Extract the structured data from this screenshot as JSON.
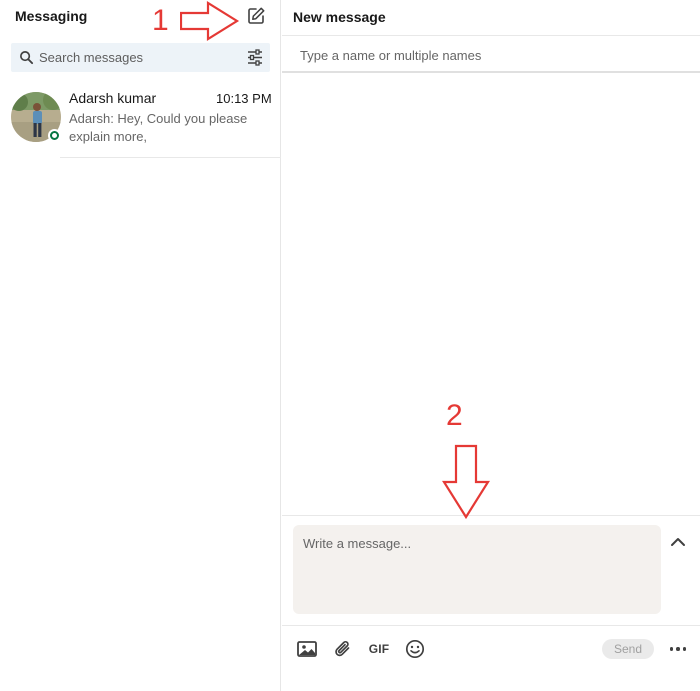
{
  "sidebar": {
    "title": "Messaging",
    "compose_icon": "compose-icon",
    "search": {
      "placeholder": "Search messages",
      "icon": "search-icon",
      "filter_icon": "filter-icon"
    },
    "conversations": [
      {
        "name": "Adarsh kumar",
        "time": "10:13 PM",
        "snippet": "Adarsh: Hey, Could you please explain more,",
        "status": "online"
      }
    ]
  },
  "main": {
    "title": "New message",
    "recipient_placeholder": "Type a name or multiple names",
    "composer": {
      "placeholder": "Write a message...",
      "expand_icon": "chevron-up-icon"
    },
    "toolbar": {
      "image_icon": "image-icon",
      "attach_icon": "paperclip-icon",
      "gif_label": "GIF",
      "emoji_icon": "emoji-icon",
      "send_label": "Send",
      "more_icon": "more-icon"
    }
  },
  "annotations": {
    "step_1": "1",
    "step_2": "2"
  },
  "colors": {
    "annotation": "#e53935",
    "presence": "#057642",
    "search_bg": "#edf3f8",
    "composer_bg": "#f4f1ee"
  }
}
